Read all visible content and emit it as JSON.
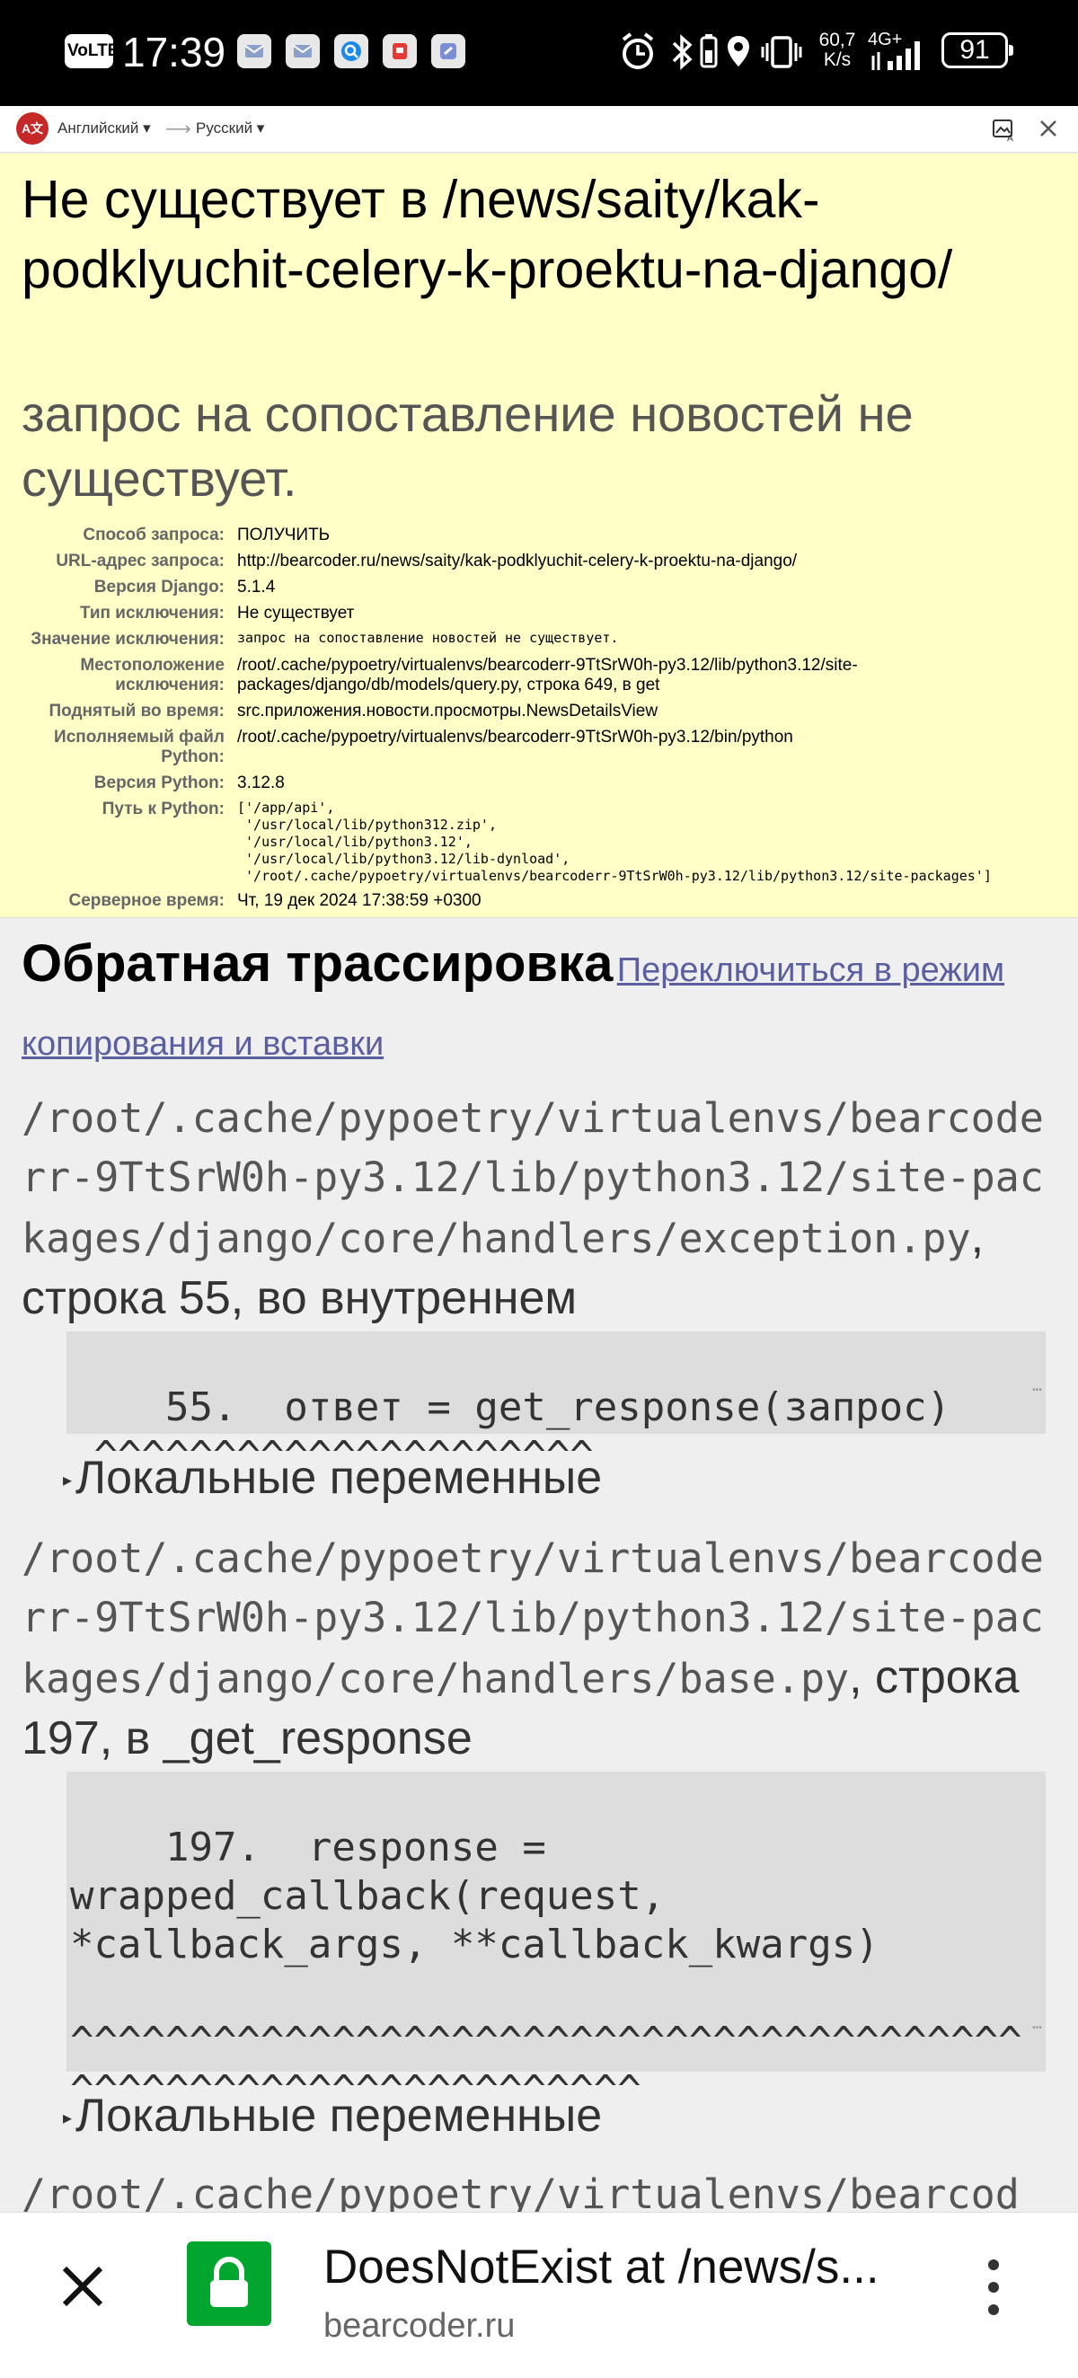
{
  "status_bar": {
    "volte": "VoLTE",
    "time": "17:39",
    "net_speed": "60,7\nK/s",
    "network": "4G+",
    "battery": "91"
  },
  "translate_bar": {
    "source_lang": "Английский ▾",
    "target_lang": "Русский ▾",
    "arrow": "⟶"
  },
  "summary": {
    "title": "Не существует в /news/saity/kak-podklyuchit-celery-k-proektu-na-django/",
    "subtitle": "запрос на сопоставление новостей не существует.",
    "meta": [
      {
        "key": "Способ запроса:",
        "value": "ПОЛУЧИТЬ"
      },
      {
        "key": "URL-адрес запроса:",
        "value": "http://bearcoder.ru/news/saity/kak-podklyuchit-celery-k-proektu-na-django/"
      },
      {
        "key": "Версия Django:",
        "value": "5.1.4"
      },
      {
        "key": "Тип исключения:",
        "value": "Не существует"
      },
      {
        "key": "Значение исключения:",
        "value": "запрос на сопоставление новостей не существует."
      },
      {
        "key": "Местоположение исключения:",
        "value": "/root/.cache/pypoetry/virtualenvs/bearcoderr-9TtSrW0h-py3.12/lib/python3.12/site-packages/django/db/models/query.py, строка 649, в get"
      },
      {
        "key": "Поднятый во время:",
        "value": "src.приложения.новости.просмотры.NewsDetailsView"
      },
      {
        "key": "Исполняемый файл Python:",
        "value": "/root/.cache/pypoetry/virtualenvs/bearcoderr-9TtSrW0h-py3.12/bin/python"
      },
      {
        "key": "Версия Python:",
        "value": "3.12.8"
      },
      {
        "key": "Путь к Python:",
        "value": "['/app/api',\n '/usr/local/lib/python312.zip',\n '/usr/local/lib/python3.12',\n '/usr/local/lib/python3.12/lib-dynload',\n '/root/.cache/pypoetry/virtualenvs/bearcoderr-9TtSrW0h-py3.12/lib/python3.12/site-packages']"
      },
      {
        "key": "Серверное время:",
        "value": "Чт, 19 дек 2024 17:38:59 +0300"
      }
    ]
  },
  "traceback": {
    "heading": "Обратная трассировка",
    "switch_link": "Переключиться в режим копирования и вставки",
    "locals_label": "Локальные переменные",
    "frames": [
      {
        "file": "/root/.cache/pypoetry/virtualenvs/bearcoderr-9TtSrW0h-py3.12/lib/python3.12/site-packages/django/core/handlers/exception.py",
        "location": ", строка 55, во внутреннем",
        "code": "55.  ответ = get_response(запрос)\n ^^^^^^^^^^^^^^^^^^^^^"
      },
      {
        "file": "/root/.cache/pypoetry/virtualenvs/bearcoderr-9TtSrW0h-py3.12/lib/python3.12/site-packages/django/core/handlers/base.py",
        "location": ", строка 197, в _get_response",
        "code": "197.  response =\nwrapped_callback(request,\n*callback_args, **callback_kwargs)\n\n^^^^^^^^^^^^^^^^^^^^^^^^^^^^^^^^^^^^^^^^^^^^^^^^^^^^^^^^^^^^^^^^"
      },
      {
        "file": "/root/.cache/pypoetry/virtualenvs/bearcod"
      }
    ]
  },
  "bottom_bar": {
    "page_title": "DoesNotExist at /news/s...",
    "domain": "bearcoder.ru"
  },
  "colors": {
    "summary_bg": "#ffffc8",
    "link": "#5b5fa0",
    "lock_green": "#00a62e"
  }
}
